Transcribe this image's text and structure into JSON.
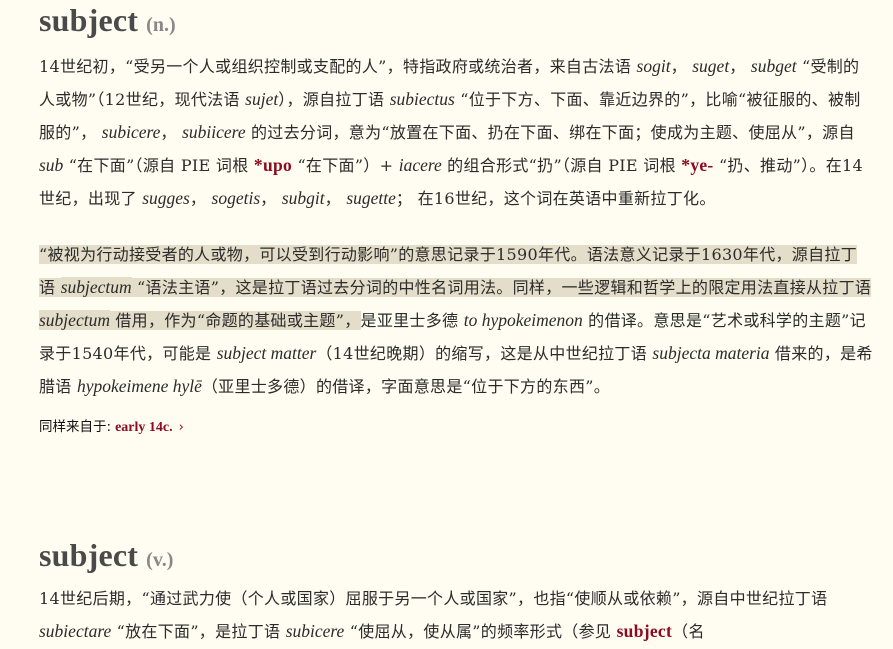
{
  "noun": {
    "headword": "subject",
    "pos": "(n.)",
    "p1": [
      {
        "t": "14世纪初，“受另一个人或组织控制或支配的人”，特指政府或统治者，来自古法语 "
      },
      {
        "t": "sogit",
        "k": "i"
      },
      {
        "t": "， "
      },
      {
        "t": "suget",
        "k": "i"
      },
      {
        "t": "， "
      },
      {
        "t": "subget",
        "k": "i"
      },
      {
        "t": " “受制的人或物”（12世纪，现代法语 "
      },
      {
        "t": "sujet",
        "k": "i"
      },
      {
        "t": "），源自拉丁语 "
      },
      {
        "t": "subiectus",
        "k": "i"
      },
      {
        "t": " “位于下方、下面、靠近边界的”，比喻“被征服的、被制服的”， "
      },
      {
        "t": "subicere",
        "k": "i"
      },
      {
        "t": "， "
      },
      {
        "t": "subiicere",
        "k": "i"
      },
      {
        "t": " 的过去分词，意为“放置在下面、扔在下面、绑在下面；使成为主题、使屈从”，源自 "
      },
      {
        "t": "sub",
        "k": "i"
      },
      {
        "t": " “在下面”（源自 PIE 词根 "
      },
      {
        "t": "*upo",
        "k": "x"
      },
      {
        "t": " “在下面”）+ "
      },
      {
        "t": "iacere",
        "k": "i"
      },
      {
        "t": " 的组合形式“扔”（源自 PIE 词根 "
      },
      {
        "t": "*ye-",
        "k": "x"
      },
      {
        "t": " “扔、推动”）。在14世纪，出现了 "
      },
      {
        "t": "sugges",
        "k": "i"
      },
      {
        "t": "， "
      },
      {
        "t": "sogetis",
        "k": "i"
      },
      {
        "t": "， "
      },
      {
        "t": "subgit",
        "k": "i"
      },
      {
        "t": "， "
      },
      {
        "t": "sugette",
        "k": "i"
      },
      {
        "t": "； 在16世纪，这个词在英语中重新拉丁化。"
      }
    ],
    "p2": [
      {
        "t": "“被视为行动接受者的人或物，可以受到行动影响”的意思记录于1590年代。语法意义记录于1630年代，源自拉丁语 ",
        "k": "h"
      },
      {
        "t": "subjectum",
        "k": "ih"
      },
      {
        "t": " “语法主语”，这是拉丁语过去分词的中性名词用法。同样，一些逻辑和哲学上的限定用法直接从拉丁语 ",
        "k": "h"
      },
      {
        "t": "subjectum",
        "k": "ih"
      },
      {
        "t": " 借用，作为“命题的基础或主题”，",
        "k": "h"
      },
      {
        "t": "是亚里士多德 "
      },
      {
        "t": "to hypokeimenon",
        "k": "i"
      },
      {
        "t": " 的借译。意思是“艺术或科学的主题”记录于1540年代，可能是 "
      },
      {
        "t": "subject matter",
        "k": "i"
      },
      {
        "t": "（14世纪晚期）的缩写，这是从中世纪拉丁语 "
      },
      {
        "t": "subjecta materia",
        "k": "i"
      },
      {
        "t": " 借来的，是希腊语 "
      },
      {
        "t": "hypokeimene hylē",
        "k": "i"
      },
      {
        "t": "（亚里士多德）的借译，字面意思是“位于下方的东西”。"
      }
    ],
    "also_label": "同样来自于:",
    "also_link": "early 14c.",
    "chevron": "›"
  },
  "verb": {
    "headword": "subject",
    "pos": "(v.)",
    "p1": [
      {
        "t": "14世纪后期，“通过武力使（个人或国家）屈服于另一个人或国家”，也指“使顺从或依赖”，源自中世纪拉丁语 "
      },
      {
        "t": "subiectare",
        "k": "i"
      },
      {
        "t": " “放在下面”，是拉丁语 "
      },
      {
        "t": "subicere",
        "k": "i"
      },
      {
        "t": " “使屈从，使从属”的频率形式（参见 "
      },
      {
        "t": "subject",
        "k": "x"
      },
      {
        "t": "（名"
      }
    ]
  }
}
